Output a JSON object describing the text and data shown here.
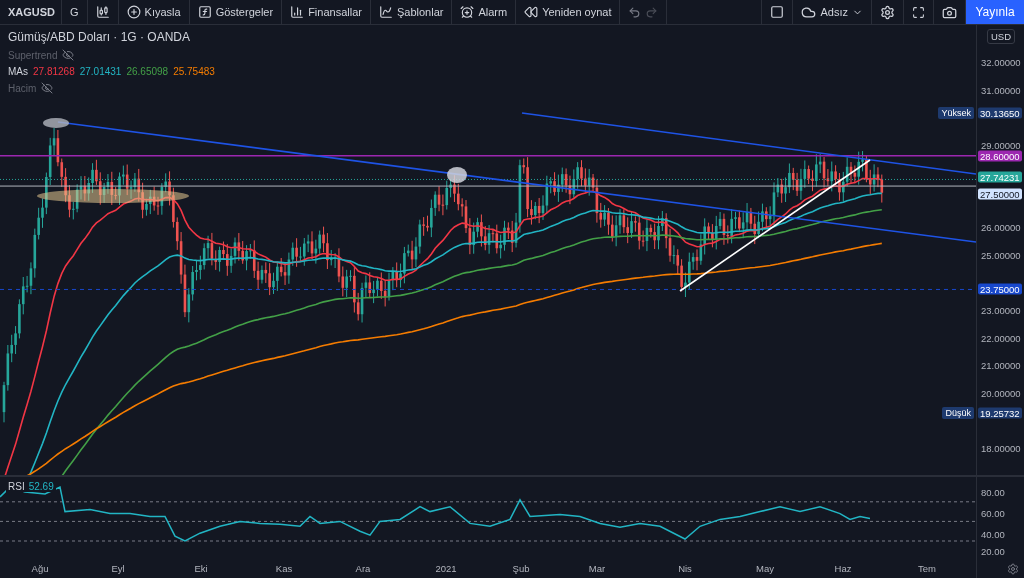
{
  "toolbar": {
    "symbol": "XAGUSD",
    "interval": "G",
    "buttons": [
      {
        "kind": "compare",
        "label": "Kıyasla"
      },
      {
        "kind": "indicators",
        "label": "Göstergeler"
      },
      {
        "kind": "financials",
        "label": "Finansallar"
      },
      {
        "kind": "templates",
        "label": "Şablonlar"
      },
      {
        "kind": "alert",
        "label": "Alarm"
      },
      {
        "kind": "replay",
        "label": "Yeniden oynat"
      }
    ],
    "layout_name": "Adsız",
    "publish": "Yayınla"
  },
  "legend": {
    "title": "Gümüş/ABD Doları · 1G · OANDA",
    "indicators": [
      {
        "name": "Supertrend",
        "hidden": true
      },
      {
        "name": "MAs",
        "hidden": false,
        "values": [
          {
            "value": "27.81268",
            "color": "#f23645"
          },
          {
            "value": "27.01431",
            "color": "#22b5c4"
          },
          {
            "value": "26.65098",
            "color": "#43a047"
          },
          {
            "value": "25.75483",
            "color": "#f57c00"
          }
        ]
      },
      {
        "name": "Hacim",
        "hidden": true
      }
    ]
  },
  "price_axis": {
    "currency": "USD",
    "ticks": [
      "32.00000",
      "31.00000",
      "29.00000",
      "26.00000",
      "25.00000",
      "23.00000",
      "22.00000",
      "21.00000",
      "20.00000",
      "18.00000"
    ],
    "labels": [
      {
        "caption": "Yüksek",
        "value": "30.13650",
        "color": "#1e3a6e"
      },
      {
        "value": "28.60000",
        "color": "#9c27b0"
      },
      {
        "value": "27.74231",
        "color": "#26a69a"
      },
      {
        "value": "27.50000",
        "color": "#d1e3ff"
      },
      {
        "value": "23.75000",
        "color": "#1848cc"
      },
      {
        "caption": "Düşük",
        "value": "19.25732",
        "color": "#1e3a6e"
      }
    ]
  },
  "rsi": {
    "label": "RSI",
    "value": "52.69",
    "ticks": [
      "80.00",
      "60.00",
      "40.00",
      "20.00"
    ]
  },
  "time_axis": [
    "Ağu",
    "Eyl",
    "Eki",
    "Kas",
    "Ara",
    "2021",
    "Şub",
    "Mar",
    "Nis",
    "May",
    "Haz",
    "Tem"
  ]
}
